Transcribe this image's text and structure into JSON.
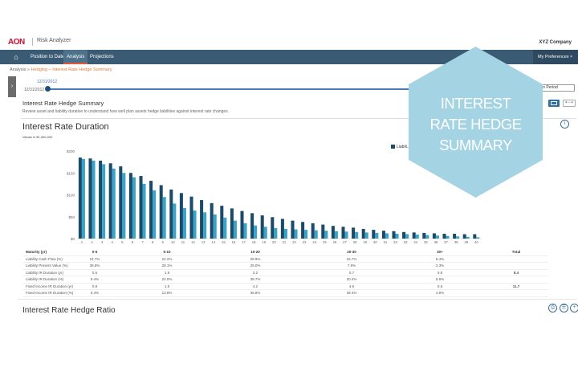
{
  "header": {
    "logo": "AON",
    "app_title": "Risk Analyzer",
    "company": "XYZ Company"
  },
  "nav": {
    "items": [
      "Position to Date",
      "Analysis",
      "Projections"
    ],
    "active": "Analysis",
    "right": "My Preferences"
  },
  "breadcrumb": {
    "root": "Analysis",
    "sep": " » ",
    "current": "Hedging – Interest Rate Hedge Summary"
  },
  "timeline": {
    "date_top": "12/31/2012",
    "date_left": "12/31/2012",
    "select_value": "...n Period"
  },
  "section": {
    "title": "Interest Rate Hedge Summary",
    "description": "Review asset and liability duration to understand how well  plan assets hedge liabilities against interest rate changes."
  },
  "chart_title": "Interest Rate Duration",
  "values_note": "Values in $1,000,000",
  "legend": {
    "label": "Liabili..."
  },
  "chart_data": {
    "type": "bar",
    "categories": [
      "1",
      "2",
      "3",
      "4",
      "5",
      "6",
      "7",
      "8",
      "9",
      "10",
      "11",
      "12",
      "13",
      "14",
      "15",
      "16",
      "17",
      "18",
      "19",
      "20",
      "21",
      "22",
      "23",
      "24",
      "25",
      "26",
      "27",
      "28",
      "29",
      "30",
      "31",
      "32",
      "33",
      "34",
      "35",
      "36",
      "37",
      "38",
      "39",
      "40"
    ],
    "ylim": [
      0,
      200
    ],
    "yticks": [
      "$200",
      "$150",
      "$100",
      "$50",
      "$0"
    ],
    "series": [
      {
        "name": "Liabili...",
        "color": "#1a4b6b",
        "values": [
          185,
          183,
          178,
          172,
          165,
          150,
          143,
          132,
          122,
          112,
          104,
          96,
          88,
          81,
          75,
          69,
          63,
          58,
          53,
          49,
          45,
          41,
          38,
          35,
          32,
          29,
          27,
          25,
          22,
          20,
          18,
          17,
          15,
          14,
          13,
          12,
          11,
          11,
          10,
          10
        ]
      },
      {
        "color": "#3aa3c6",
        "values": [
          182,
          178,
          170,
          160,
          150,
          140,
          125,
          110,
          95,
          80,
          70,
          64,
          60,
          55,
          48,
          41,
          35,
          30,
          27,
          24,
          22,
          21,
          20,
          19,
          18,
          17,
          16,
          15,
          14,
          13,
          12,
          11,
          10,
          9,
          8,
          7,
          6,
          5,
          4,
          3
        ]
      }
    ]
  },
  "table": {
    "header": [
      "Maturity (yr)",
      "0-5",
      "5-10",
      "10-20",
      "20-30",
      "30+",
      "Total"
    ],
    "rows": [
      [
        "Liability Cash Flow (%)",
        "24.7%",
        "22.2%",
        "28.9%",
        "15.7%",
        "8.4%",
        ""
      ],
      [
        "Liability Present Value (%)",
        "36.8%",
        "28.1%",
        "25.0%",
        "7.9%",
        "2.3%",
        ""
      ],
      [
        "Liability IR Duration (yr)",
        "0.6",
        "1.8",
        "3.2",
        "0.7",
        "0.8",
        "8.4"
      ],
      [
        "Liability IR Duration (%)",
        "9.4%",
        "22.0%",
        "38.7%",
        "20.4%",
        "9.6%",
        ""
      ],
      [
        "Fixed Income IR Duration (yr)",
        "0.8",
        "1.6",
        "4.2",
        "4.6",
        "0.5",
        "11.7"
      ],
      [
        "Fixed Income IR Duration (%)",
        "6.4%",
        "13.8%",
        "35.8%",
        "39.4%",
        "4.6%",
        ""
      ]
    ]
  },
  "ratio_title": "Interest Rate Hedge Ratio",
  "overlay": {
    "line1": "INTEREST",
    "line2": "RATE HEDGE",
    "line3": "SUMMARY",
    "color": "#a4d3e3"
  }
}
